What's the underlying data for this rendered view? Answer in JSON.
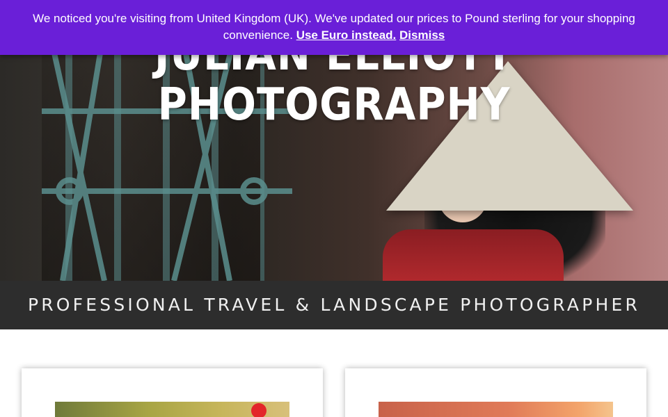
{
  "hero": {
    "title_line1": "JULIAN ELLIOTT",
    "title_line2": "PHOTOGRAPHY"
  },
  "notice": {
    "message": "We noticed you're visiting from United Kingdom (UK). We've updated our prices to Pound sterling for your shopping convenience.",
    "use_euro_link": "Use Euro instead.",
    "dismiss_link": "Dismiss",
    "background_color": "#6a1fd8"
  },
  "tagline": {
    "text": "PROFESSIONAL TRAVEL & LANDSCAPE PHOTOGRAPHER",
    "background_color": "#2d2d2d"
  }
}
